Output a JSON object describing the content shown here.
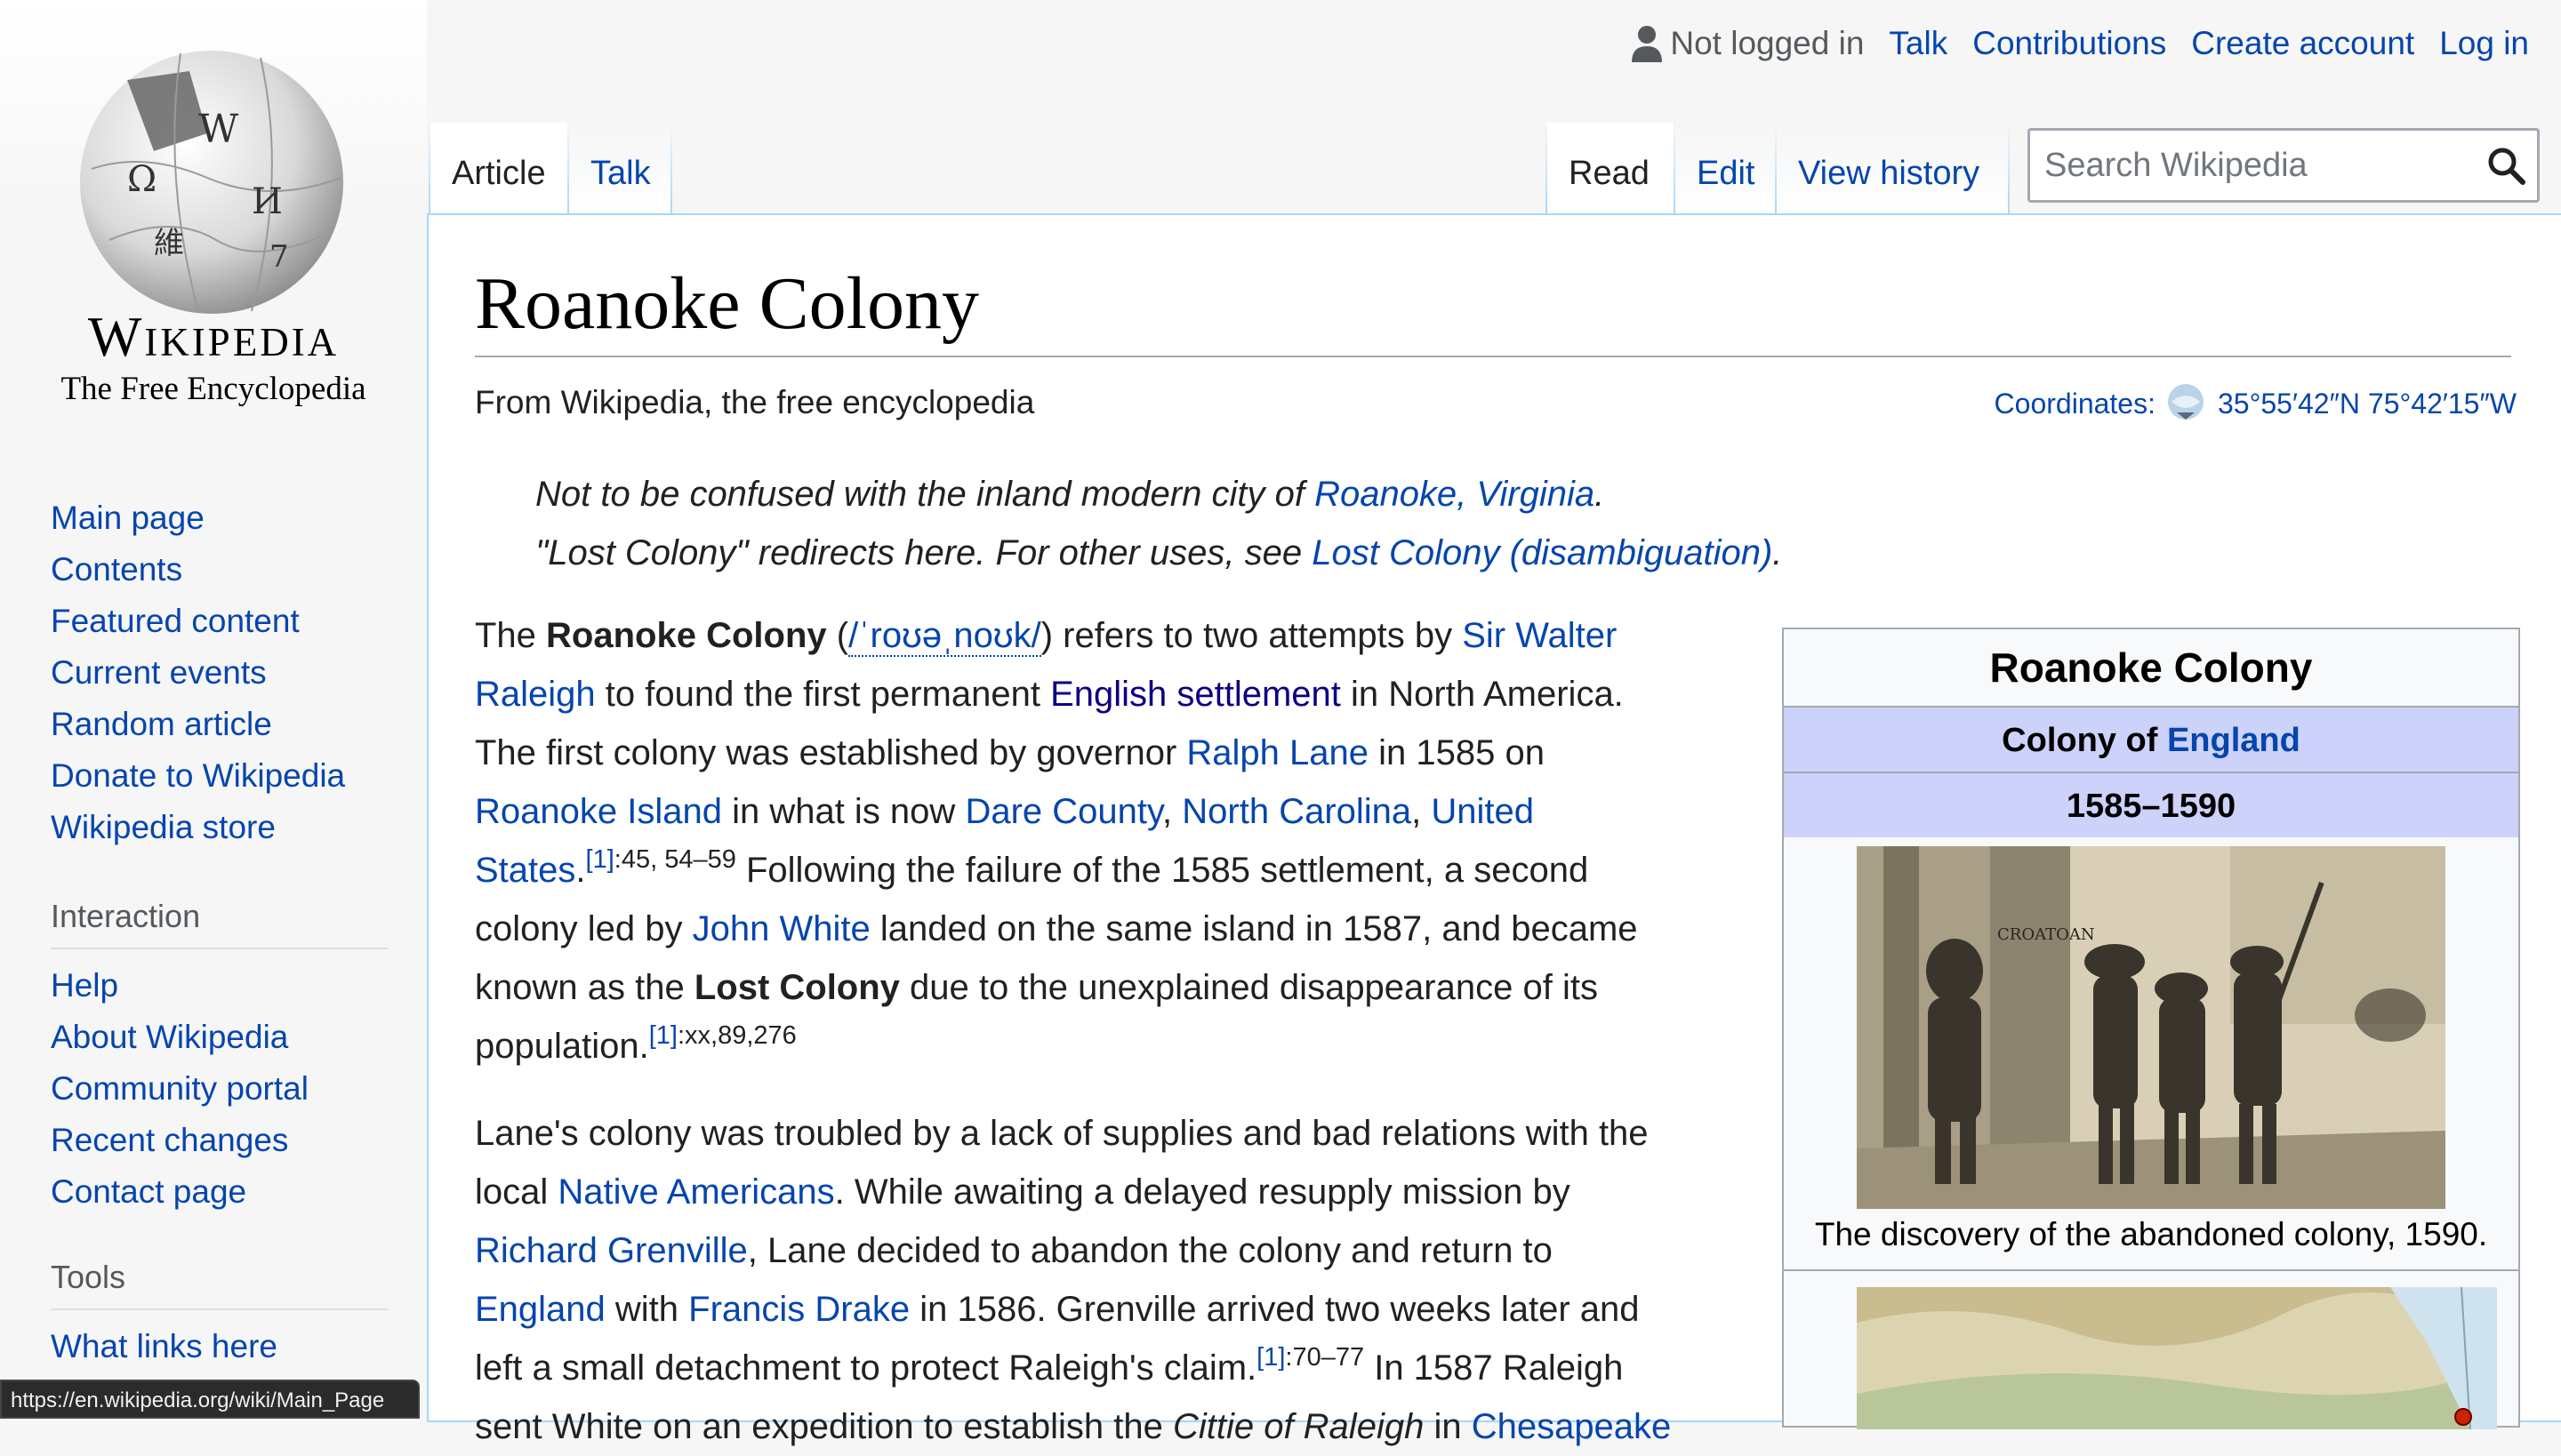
{
  "sidebar": {
    "wordmark": "Wikipedia",
    "tagline": "The Free Encyclopedia",
    "navigation": [
      "Main page",
      "Contents",
      "Featured content",
      "Current events",
      "Random article",
      "Donate to Wikipedia",
      "Wikipedia store"
    ],
    "interaction_heading": "Interaction",
    "interaction": [
      "Help",
      "About Wikipedia",
      "Community portal",
      "Recent changes",
      "Contact page"
    ],
    "tools_heading": "Tools",
    "tools": [
      "What links here"
    ]
  },
  "status_bar": "https://en.wikipedia.org/wiki/Main_Page",
  "personal": {
    "not_logged_in": "Not logged in",
    "talk": "Talk",
    "contributions": "Contributions",
    "create_account": "Create account",
    "log_in": "Log in"
  },
  "tabs": {
    "article": "Article",
    "talk": "Talk",
    "read": "Read",
    "edit": "Edit",
    "view_history": "View history"
  },
  "search": {
    "placeholder": "Search Wikipedia"
  },
  "article": {
    "title": "Roanoke Colony",
    "site_sub": "From Wikipedia, the free encyclopedia",
    "coords_label": "Coordinates:",
    "coords_value": "35°55′42″N 75°42′15″W",
    "hatnote1_pre": "Not to be confused with the inland modern city of ",
    "hatnote1_link": "Roanoke, Virginia",
    "hatnote1_post": ".",
    "hatnote2_pre": "\"Lost Colony\" redirects here. For other uses, see ",
    "hatnote2_link": "Lost Colony (disambiguation)",
    "hatnote2_post": ".",
    "p1": {
      "t1": "The ",
      "b1": "Roanoke Colony",
      "t2": " (",
      "ipa": "/ˈroʊəˌnoʊk/",
      "t3": ") refers to two attempts by ",
      "l1": "Sir Walter",
      "l1b": "Raleigh",
      "t4": " to found the first permanent ",
      "l2": "English settlement",
      "t5": " in North America.",
      "t6": "The first colony was established by governor ",
      "l3": "Ralph Lane",
      "t7": " in 1585 on",
      "l4": "Roanoke Island",
      "t8": " in what is now ",
      "l5": "Dare County",
      "t9": ", ",
      "l6": "North Carolina",
      "t10": ", ",
      "l7": "United",
      "l7b": "States",
      "t11": ".",
      "ref1": "[1]",
      "ref1_pages": ":45, 54–59",
      "t12": " Following the failure of the 1585 settlement, a second",
      "t13": "colony led by ",
      "l8": "John White",
      "t14": " landed on the same island in 1587, and became",
      "t15": "known as the ",
      "b2": "Lost Colony",
      "t16": " due to the unexplained disappearance of its",
      "t17": "population.",
      "ref2": "[1]",
      "ref2_pages": ":xx,89,276"
    },
    "p2": {
      "t1": "Lane's colony was troubled by a lack of supplies and bad relations with the",
      "t2": "local ",
      "l1": "Native Americans",
      "t3": ". While awaiting a delayed resupply mission by",
      "l2": "Richard Grenville",
      "t4": ", Lane decided to abandon the colony and return to",
      "l3": "England",
      "t5": " with ",
      "l4": "Francis Drake",
      "t6": " in 1586. Grenville arrived two weeks later and",
      "t7": "left a small detachment to protect Raleigh's claim.",
      "ref": "[1]",
      "ref_pages": ":70–77",
      "t8": " In 1587 Raleigh",
      "t9": "sent White on an expedition to establish the ",
      "i1": "Cittie of Raleigh",
      "t10": " in ",
      "l5": "Chesapeake"
    }
  },
  "infobox": {
    "title": "Roanoke Colony",
    "subtitle_pre": "Colony of ",
    "subtitle_link": "England",
    "years": "1585–1590",
    "image_text": "CROATOAN",
    "caption": "The discovery of the abandoned colony, 1590."
  },
  "colors": {
    "link": "#0645ad",
    "link_visited_dark": "#0b0080",
    "infobox_band": "#ccd2f9",
    "border": "#a7d7f9"
  }
}
